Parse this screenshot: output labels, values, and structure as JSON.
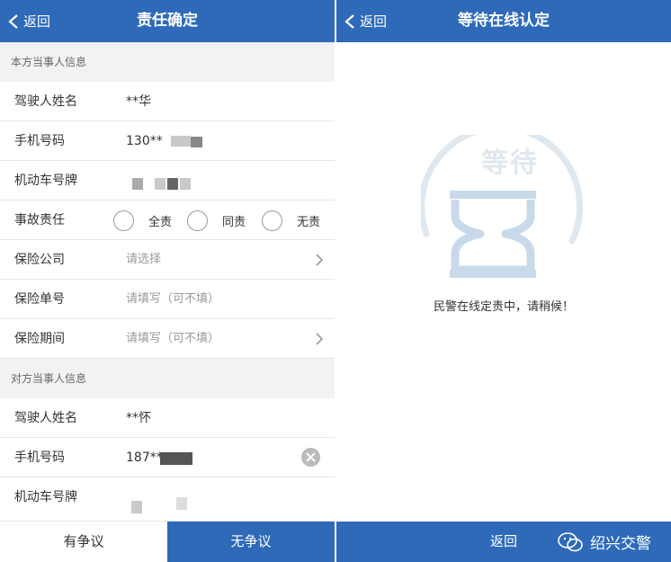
{
  "left": {
    "nav": {
      "back_label": "返回",
      "title": "责任确定"
    },
    "own_section": "本方当事人信息",
    "own": {
      "driver_label": "驾驶人姓名",
      "driver_value": "**华",
      "phone_label": "手机号码",
      "phone_value": "130**",
      "plate_label": "机动车号牌",
      "liability_label": "事故责任",
      "liability_options": [
        "全责",
        "同责",
        "无责"
      ],
      "insurer_label": "保险公司",
      "insurer_placeholder": "请选择",
      "policy_label": "保险单号",
      "policy_placeholder": "请填写（可不填）",
      "period_label": "保险期间",
      "period_placeholder": "请填写（可不填）"
    },
    "other_section": "对方当事人信息",
    "other": {
      "driver_label": "驾驶人姓名",
      "driver_value": "**怀",
      "phone_label": "手机号码",
      "phone_value": "187**",
      "plate_label": "机动车号牌"
    },
    "buttons": {
      "dispute": "有争议",
      "no_dispute": "无争议"
    }
  },
  "right": {
    "nav": {
      "back_label": "返回",
      "title": "等待在线认定"
    },
    "wait_icon_text": "等待",
    "message": "民警在线定责中，请稍候！",
    "back_button": "返回",
    "watermark": "绍兴交警"
  },
  "colors": {
    "brand_blue": "#2e6ab8",
    "background": "#f2f2f2"
  }
}
